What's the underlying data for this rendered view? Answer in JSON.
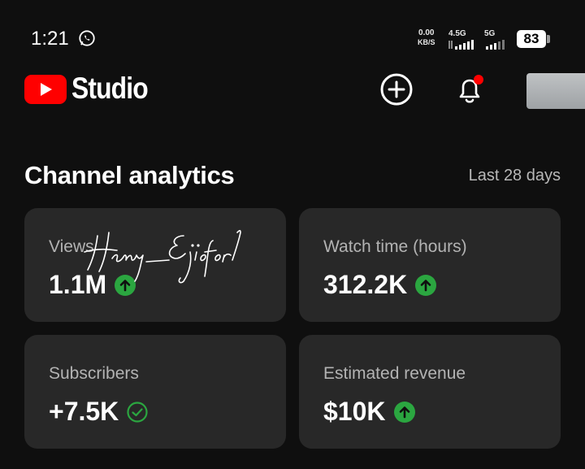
{
  "status_bar": {
    "time": "1:21",
    "speed_value": "0.00",
    "speed_unit": "KB/S",
    "network_1": "4.5G",
    "network_2": "5G",
    "battery": "83"
  },
  "header": {
    "app_name": "Studio"
  },
  "analytics": {
    "title": "Channel analytics",
    "range": "Last 28 days",
    "cards": [
      {
        "label": "Views",
        "value": "1.1M",
        "indicator": "up-arrow"
      },
      {
        "label": "Watch time (hours)",
        "value": "312.2K",
        "indicator": "up-arrow"
      },
      {
        "label": "Subscribers",
        "value": "+7.5K",
        "indicator": "check"
      },
      {
        "label": "Estimated revenue",
        "value": "$10K",
        "indicator": "up-arrow"
      }
    ]
  },
  "watermark": {
    "signature": "Henry_Ejiofor1"
  },
  "colors": {
    "background": "#0f0f0f",
    "card": "#282828",
    "youtube_red": "#ff0000",
    "trend_green": "#2ba640",
    "notification_dot": "#ff0000"
  }
}
